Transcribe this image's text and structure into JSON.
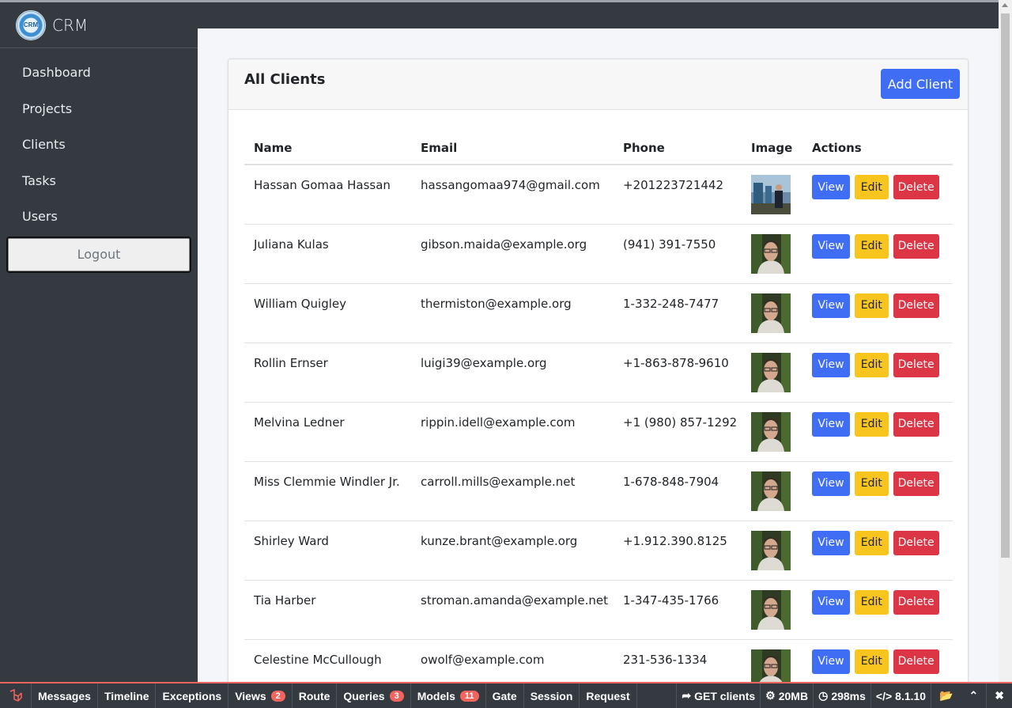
{
  "brand": {
    "name": "CRM"
  },
  "sidebar": {
    "items": [
      {
        "label": "Dashboard"
      },
      {
        "label": "Projects"
      },
      {
        "label": "Clients"
      },
      {
        "label": "Tasks"
      },
      {
        "label": "Users"
      }
    ],
    "logout_label": "Logout"
  },
  "card": {
    "title": "All Clients",
    "add_button_label": "Add Client"
  },
  "table": {
    "columns": [
      "Name",
      "Email",
      "Phone",
      "Image",
      "Actions"
    ],
    "action_labels": {
      "view": "View",
      "edit": "Edit",
      "delete": "Delete"
    },
    "rows": [
      {
        "name": "Hassan Gomaa Hassan",
        "email": "hassangomaa974@gmail.com",
        "phone": "+201223721442",
        "image": "photo-outdoor"
      },
      {
        "name": "Juliana Kulas",
        "email": "gibson.maida@example.org",
        "phone": "(941) 391-7550",
        "image": "avatar-default"
      },
      {
        "name": "William Quigley",
        "email": "thermiston@example.org",
        "phone": "1-332-248-7477",
        "image": "avatar-default"
      },
      {
        "name": "Rollin Ernser",
        "email": "luigi39@example.org",
        "phone": "+1-863-878-9610",
        "image": "avatar-default"
      },
      {
        "name": "Melvina Ledner",
        "email": "rippin.idell@example.com",
        "phone": "+1 (980) 857-1292",
        "image": "avatar-default"
      },
      {
        "name": "Miss Clemmie Windler Jr.",
        "email": "carroll.mills@example.net",
        "phone": "1-678-848-7904",
        "image": "avatar-default"
      },
      {
        "name": "Shirley Ward",
        "email": "kunze.brant@example.org",
        "phone": "+1.912.390.8125",
        "image": "avatar-default"
      },
      {
        "name": "Tia Harber",
        "email": "stroman.amanda@example.net",
        "phone": "1-347-435-1766",
        "image": "avatar-default"
      },
      {
        "name": "Celestine McCullough",
        "email": "owolf@example.com",
        "phone": "231-536-1334",
        "image": "avatar-default"
      }
    ]
  },
  "debugbar": {
    "tabs": [
      {
        "label": "Messages",
        "count": ""
      },
      {
        "label": "Timeline",
        "count": ""
      },
      {
        "label": "Exceptions",
        "count": ""
      },
      {
        "label": "Views",
        "count": "2"
      },
      {
        "label": "Route",
        "count": ""
      },
      {
        "label": "Queries",
        "count": "3"
      },
      {
        "label": "Models",
        "count": "11"
      },
      {
        "label": "Gate",
        "count": ""
      },
      {
        "label": "Session",
        "count": ""
      },
      {
        "label": "Request",
        "count": ""
      }
    ],
    "route": "GET clients",
    "memory": "20MB",
    "time": "298ms",
    "php_version": "8.1.10"
  },
  "colors": {
    "primary": "#3f6ef5",
    "warning": "#f7c51d",
    "danger": "#dc3545",
    "sidebar": "#343a40",
    "debug_accent": "#f4645f"
  }
}
